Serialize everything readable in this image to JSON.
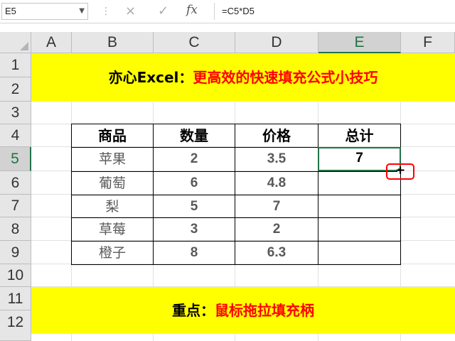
{
  "formula_bar": {
    "name_box": "E5",
    "formula": "=C5*D5",
    "cancel_icon": "×",
    "enter_icon": "✓",
    "fx_icon": "fx"
  },
  "columns": [
    "A",
    "B",
    "C",
    "D",
    "E",
    "F"
  ],
  "rows": [
    "1",
    "2",
    "3",
    "4",
    "5",
    "6",
    "7",
    "8",
    "9",
    "10",
    "11",
    "12"
  ],
  "banner_top": {
    "prefix": "亦心Excel：",
    "highlight": "更高效的快速填充公式小技巧"
  },
  "banner_bottom": {
    "prefix": "重点：",
    "highlight": "鼠标拖拉填充柄"
  },
  "table": {
    "headers": [
      "商品",
      "数量",
      "价格",
      "总计"
    ],
    "rows": [
      [
        "苹果",
        "2",
        "3.5",
        "7"
      ],
      [
        "葡萄",
        "6",
        "4.8",
        ""
      ],
      [
        "梨",
        "5",
        "7",
        ""
      ],
      [
        "草莓",
        "3",
        "2",
        ""
      ],
      [
        "橙子",
        "8",
        "6.3",
        ""
      ]
    ]
  },
  "colors": {
    "selection": "#217346",
    "banner": "#ffff00",
    "highlight_text": "#ff0000"
  }
}
